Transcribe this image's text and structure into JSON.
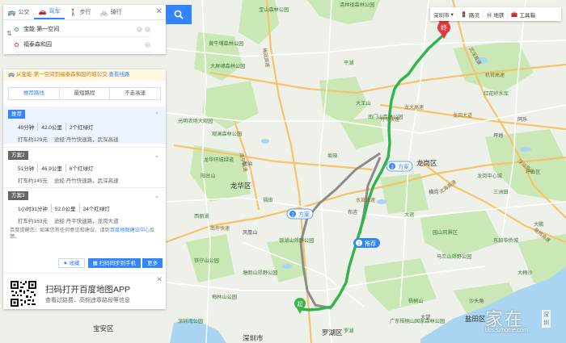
{
  "modes": [
    {
      "icon": "bus-icon",
      "label": "公交",
      "active": false
    },
    {
      "icon": "car-icon",
      "label": "驾车",
      "active": true
    },
    {
      "icon": "walk-icon",
      "label": "步行",
      "active": false
    },
    {
      "icon": "bike-icon",
      "label": "骑行",
      "active": false
    }
  ],
  "route": {
    "start": "宝能·第一空间",
    "end": "福泰森和园"
  },
  "transit_note": {
    "text": "从宝能·第一空间到福泰森和园的城公交",
    "link": "查看线路"
  },
  "plan_tabs": [
    "推荐路线",
    "最短路程",
    "不走高速"
  ],
  "plans": [
    {
      "tag": "推荐",
      "time": "49分钟",
      "dist": "42.0公里",
      "lights": "2个红绿灯",
      "fare": "打车约129元",
      "via_label": "途经:",
      "via": "丹竹快速路，武深高速"
    },
    {
      "tag": "方案2",
      "time": "51分钟",
      "dist": "46.9公里",
      "lights": "6个红绿灯",
      "fare": "打车约145元",
      "via_label": "途经:",
      "via": "丹竹快速路，武深高速"
    },
    {
      "tag": "方案3",
      "time": "1小时31分钟",
      "dist": "52.0公里",
      "lights": "24个红绿灯",
      "fare": "打车约163元",
      "via_label": "途经:",
      "via": "丹平快速路，龙岗大道"
    }
  ],
  "tip": {
    "text": "百度提醒您：如果您有任何意见和建议，请到",
    "link": "百度地图建议中心",
    "end": "反馈。"
  },
  "actions": {
    "fav": "收藏",
    "send": "扫码同步到手机",
    "more": "更多"
  },
  "promo": {
    "title": "扫码打开百度地图APP",
    "subtitle": "查看过路费、高频违章路段等信息"
  },
  "toolbar": {
    "city": "深圳市",
    "traffic": "路况",
    "subway": "地铁",
    "tools": "工具箱"
  },
  "route_labels": {
    "recommend": "推荐",
    "plan2": "方案",
    "plan3": "方案"
  },
  "map_labels": {
    "districts": [
      "龙华区",
      "龙岗区",
      "盐田区",
      "福田区",
      "罗湖区",
      "宝安区",
      "深圳市"
    ],
    "places": [
      "宝山森林公园",
      "清林径森林公园",
      "黄牛埔森林公园",
      "大屏嶂森林公园",
      "大王山",
      "南门山森林公园",
      "光明农场大观园",
      "平湖",
      "观澜森林公园",
      "龙华环城绿道",
      "坂田",
      "大运",
      "龙岗中心城",
      "阳台山",
      "福田",
      "罗湖",
      "梅林山公园",
      "深圳湾公园",
      "梧桐山",
      "三洲田",
      "大梅沙",
      "东部华侨城",
      "西丽湖",
      "塘朗山郊野公园",
      "银湖山郊野公园",
      "广东梧桐山国家森林公园",
      "马峦山郊野公园",
      "红花岭水库",
      "坪山区",
      "大鹏",
      "园山风景区",
      "铁仔山公园",
      "凤凰山",
      "同乐",
      "布吉",
      "横岗",
      "坪地",
      "大望",
      "沙头角",
      "民治"
    ],
    "roads": [
      "沈海高速",
      "机荷高速",
      "水官高速",
      "梅观高速",
      "龙大高速",
      "南坪快速",
      "深汕高速",
      "清平高速",
      "丹平快速",
      "武深高速",
      "盐排高速",
      "龙岗大道"
    ]
  },
  "watermark": {
    "text": "家在",
    "badge": "深圳",
    "url": "bbs.szhome.com"
  },
  "colors": {
    "accent": "#3385ff",
    "route_main": "#2fb54a",
    "route_alt": "#8c8c8c",
    "start": "#3ab54a",
    "end": "#e4393c"
  }
}
